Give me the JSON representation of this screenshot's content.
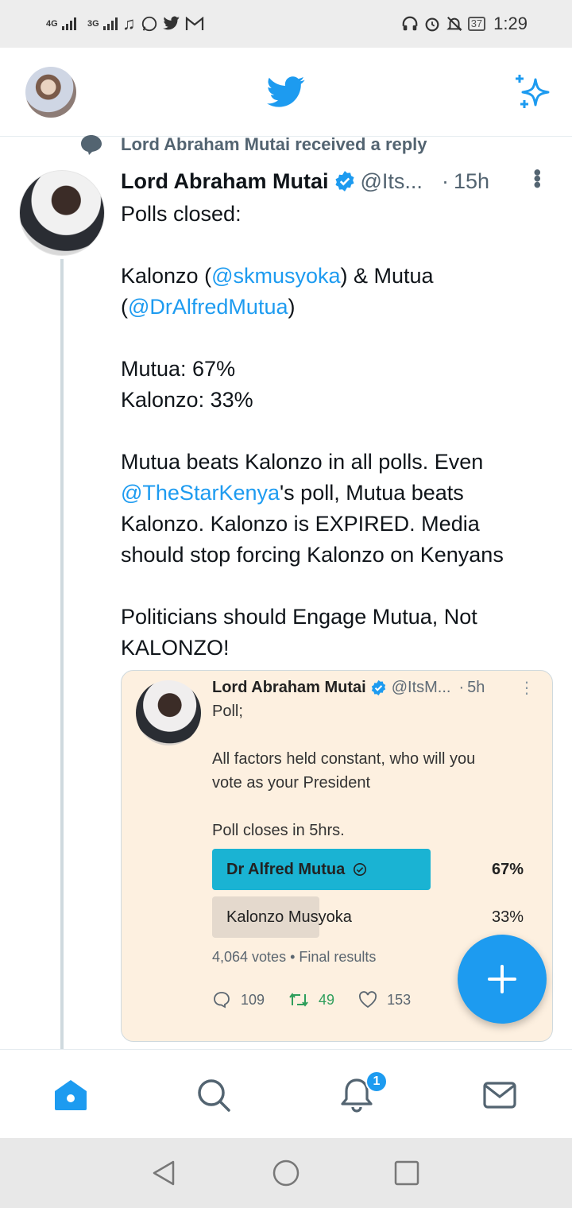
{
  "status_bar": {
    "network_1": "4G",
    "network_2": "3G",
    "battery": "37",
    "time": "1:29",
    "icons": [
      "signal-icon",
      "signal-icon",
      "music-icon",
      "whatsapp-icon",
      "twitter-icon",
      "gmail-icon",
      "headphones-icon",
      "alarm-icon",
      "mute-icon",
      "battery-icon"
    ]
  },
  "header": {
    "logo": "twitter-bird-icon",
    "action": "sparkle-icon"
  },
  "context": {
    "text": "Lord Abraham Mutai received a reply"
  },
  "tweet": {
    "name": "Lord Abraham Mutai",
    "handle": "@Its...",
    "dot": "·",
    "time": "15h",
    "line1": "Polls closed:",
    "line2_pre": "Kalonzo (",
    "mention1": "@skmusyoka",
    "line2_mid": ") & Mutua",
    "line3_pre": "(",
    "mention2": "@DrAlfredMutua",
    "line3_post": ")",
    "line4": "Mutua: 67%",
    "line5": "Kalonzo: 33%",
    "line6": "Mutua beats Kalonzo in all polls. Even",
    "mention3": "@TheStarKenya",
    "line7_post": "'s poll, Mutua beats",
    "line8": "Kalonzo. Kalonzo is EXPIRED. Media",
    "line9": "should stop forcing Kalonzo on Kenyans",
    "line10": "Politicians should Engage Mutua, Not",
    "line11": "KALONZO!"
  },
  "quote": {
    "name": "Lord Abraham Mutai",
    "handle": "@ItsM...",
    "dot": "·",
    "time": "5h",
    "text": "Poll;\n\nAll factors held constant, who will you\nvote as your President\n\nPoll closes in 5hrs.",
    "poll": [
      {
        "label": "Dr Alfred Mutua",
        "percent": "67%",
        "fraction": 0.67
      },
      {
        "label": "Kalonzo Musyoka",
        "percent": "33%",
        "fraction": 0.33
      }
    ],
    "meta": "4,064 votes • Final results",
    "replies": "109",
    "retweets": "49",
    "likes": "153"
  },
  "colors": {
    "accent": "#1d9bf0",
    "poll_winner": "#1ab3d3",
    "poll_loser": "#e4d9cd",
    "quote_bg": "#fdf0e0"
  },
  "bottom_nav": {
    "notifications_badge": "1",
    "items": [
      "home-icon",
      "search-icon",
      "notifications-icon",
      "messages-icon"
    ]
  }
}
